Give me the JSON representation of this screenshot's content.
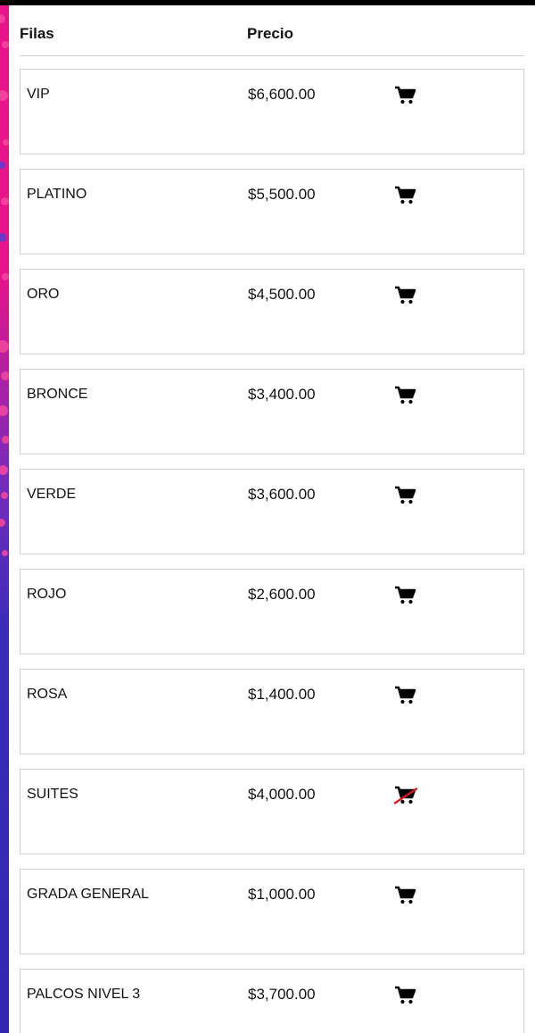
{
  "table": {
    "headers": {
      "rows_label": "Filas",
      "price_label": "Precio"
    },
    "rows": [
      {
        "name": "VIP",
        "price": "$6,600.00",
        "cart_icon": "cart-icon",
        "available": true
      },
      {
        "name": "PLATINO",
        "price": "$5,500.00",
        "cart_icon": "cart-icon",
        "available": true
      },
      {
        "name": "ORO",
        "price": "$4,500.00",
        "cart_icon": "cart-icon",
        "available": true
      },
      {
        "name": "BRONCE",
        "price": "$3,400.00",
        "cart_icon": "cart-icon",
        "available": true
      },
      {
        "name": "VERDE",
        "price": "$3,600.00",
        "cart_icon": "cart-icon",
        "available": true
      },
      {
        "name": "ROJO",
        "price": "$2,600.00",
        "cart_icon": "cart-icon",
        "available": true
      },
      {
        "name": "ROSA",
        "price": "$1,400.00",
        "cart_icon": "cart-icon",
        "available": true
      },
      {
        "name": "SUITES",
        "price": "$4,000.00",
        "cart_icon": "cart-unavailable-icon",
        "available": false
      },
      {
        "name": "GRADA GENERAL",
        "price": "$1,000.00",
        "cart_icon": "cart-icon",
        "available": true
      },
      {
        "name": "PALCOS NIVEL 3",
        "price": "$3,700.00",
        "cart_icon": "cart-icon",
        "available": true
      }
    ]
  },
  "colors": {
    "side_strip_top": "#e8148a",
    "side_strip_bottom": "#3226b0",
    "unavailable_strike": "#e0141e"
  }
}
